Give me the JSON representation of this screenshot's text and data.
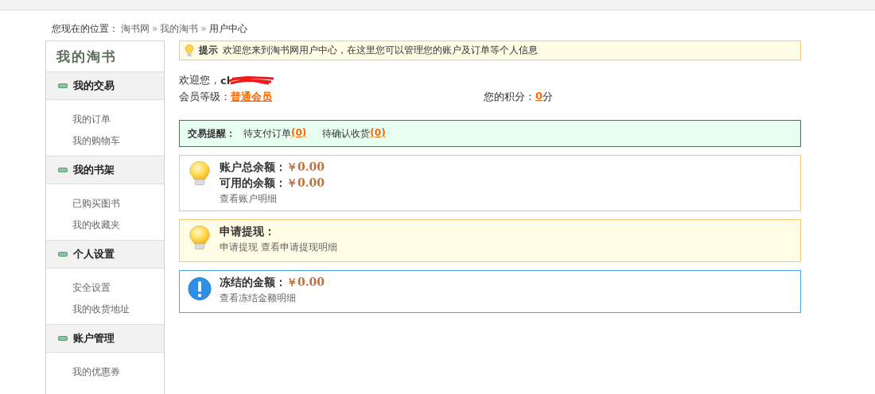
{
  "breadcrumb": {
    "label": "您现在的位置：",
    "links": [
      "淘书网",
      "我的淘书"
    ],
    "separator": "»",
    "current": "用户中心"
  },
  "sidebar": {
    "title": "我的淘书",
    "groups": [
      {
        "title": "我的交易",
        "expanded": true,
        "items": [
          "我的订单",
          "我的购物车"
        ]
      },
      {
        "title": "我的书架",
        "expanded": true,
        "items": [
          "已购买图书",
          "我的收藏夹"
        ]
      },
      {
        "title": "个人设置",
        "expanded": true,
        "items": [
          "安全设置",
          "我的收货地址"
        ]
      },
      {
        "title": "账户管理",
        "expanded": true,
        "items": [
          "我的优惠券"
        ]
      }
    ]
  },
  "notice": {
    "label": "提示",
    "text": "欢迎您来到淘书网用户中心，在这里您可以管理您的账户及订单等个人信息"
  },
  "welcome": {
    "label": "欢迎您，",
    "username": "cl"
  },
  "member": {
    "label": "会员等级：",
    "level": "普通会员",
    "points_label": "您的积分：",
    "points": "0",
    "points_unit": "分"
  },
  "trade_alert": {
    "label": "交易提醒：",
    "items": [
      {
        "label": "待支付订单",
        "count": "(0)"
      },
      {
        "label": "待确认收货",
        "count": "(0)"
      }
    ]
  },
  "panels": [
    {
      "kind": "info",
      "lines": [
        {
          "label": "账户总余额：",
          "amount": "￥0.00"
        },
        {
          "label": "可用的余额：",
          "amount": "￥0.00"
        }
      ],
      "links": [
        "查看账户明细"
      ]
    },
    {
      "kind": "warn",
      "lines": [
        {
          "label": "申请提现："
        }
      ],
      "links": [
        "申请提现",
        "查看申请提现明细"
      ]
    },
    {
      "kind": "alert",
      "lines": [
        {
          "label": "冻结的金额：",
          "amount": "￥0.00"
        }
      ],
      "links": [
        "查看冻结金额明细"
      ]
    }
  ]
}
